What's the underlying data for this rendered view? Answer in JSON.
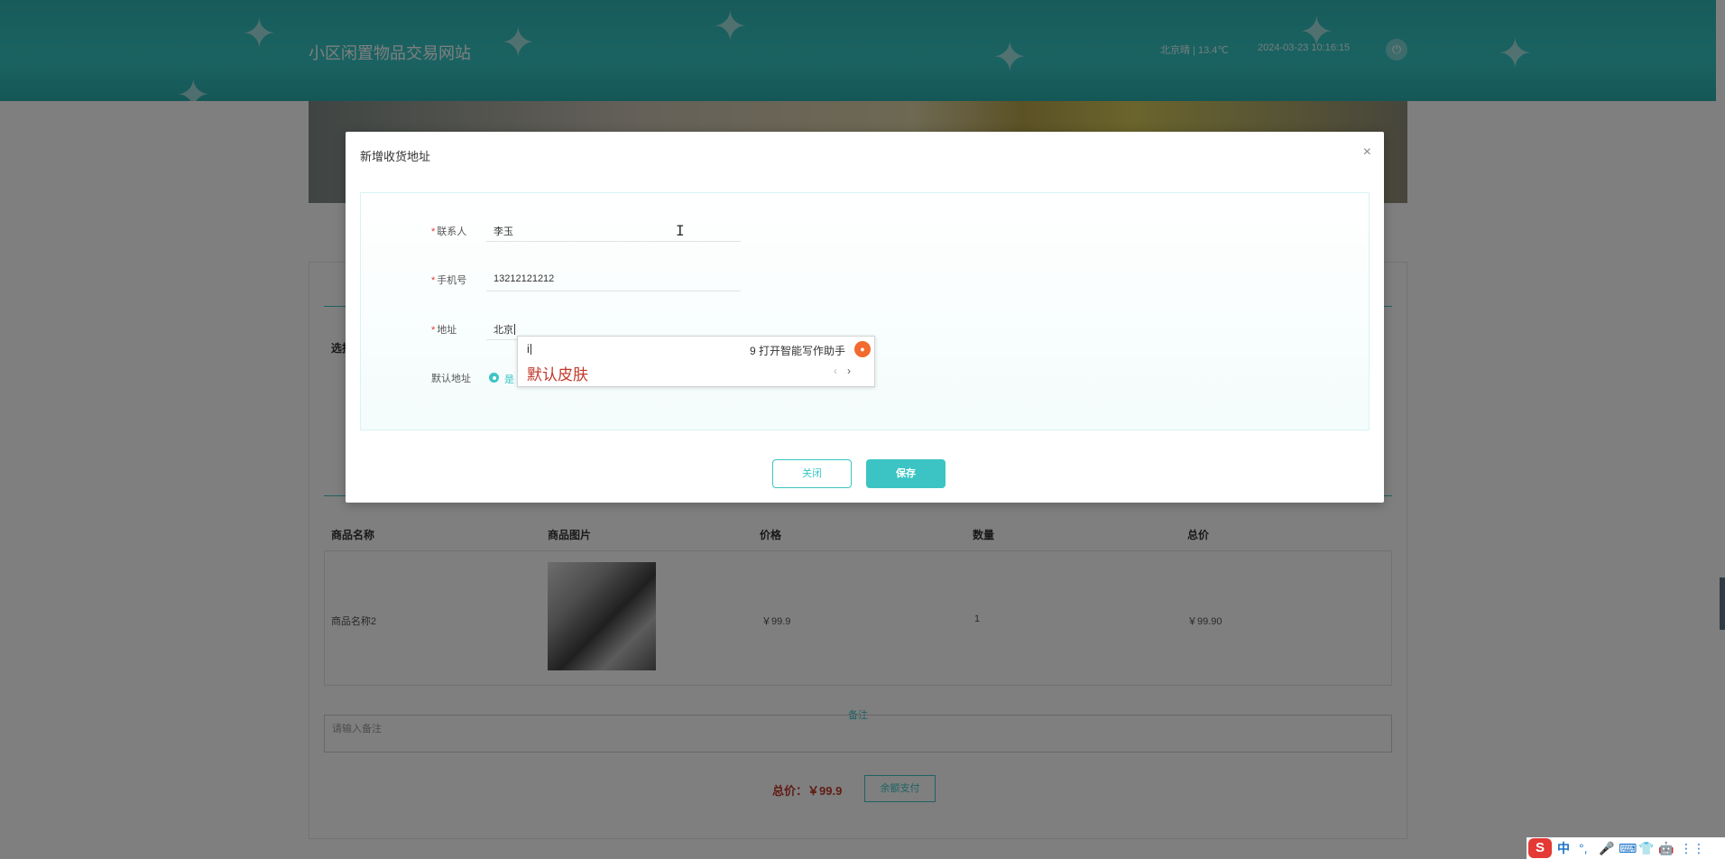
{
  "header": {
    "site_title": "小区闲置物品交易网站",
    "weather": "北京晴 | 13.4℃",
    "datetime": "2024-03-23  10:16:15",
    "power_icon": "⏻"
  },
  "page": {
    "address_select_label": "选择",
    "table_headers": [
      "商品名称",
      "商品图片",
      "价格",
      "数量",
      "总价"
    ],
    "row": {
      "name": "商品名称2",
      "price": "￥99.9",
      "qty": "1",
      "total": "￥99.90"
    },
    "remark_label": "备注",
    "remark_placeholder": "请输入备注",
    "total_text": "总价：￥99.9",
    "pay_button": "余额支付"
  },
  "modal": {
    "title": "新增收货地址",
    "close_glyph": "×",
    "required_mark": "*",
    "contact_label": "联系人",
    "contact_value": "李玉",
    "phone_label": "手机号",
    "phone_value": "13212121212",
    "address_label": "地址",
    "address_value": "北京",
    "default_label": "默认地址",
    "default_option": "是",
    "close_button": "关闭",
    "save_button": "保存"
  },
  "ime": {
    "composition": "i",
    "hint": "9 打开智能写作助手",
    "candidate": "默认皮肤",
    "prev_glyph": "‹",
    "next_glyph": "›"
  },
  "tray": {
    "logo": "S",
    "lang": "中",
    "punct": "°,",
    "mic_icon": "🎤",
    "keyboard_icon": "⌨",
    "skin_icon": "👕",
    "robot_icon": "🤖",
    "grid_icon": "⋮⋮"
  },
  "colors": {
    "accent": "#3cc4c4",
    "header": "#35c6c4",
    "danger": "#c0392b",
    "ime_brand": "#e53935"
  }
}
